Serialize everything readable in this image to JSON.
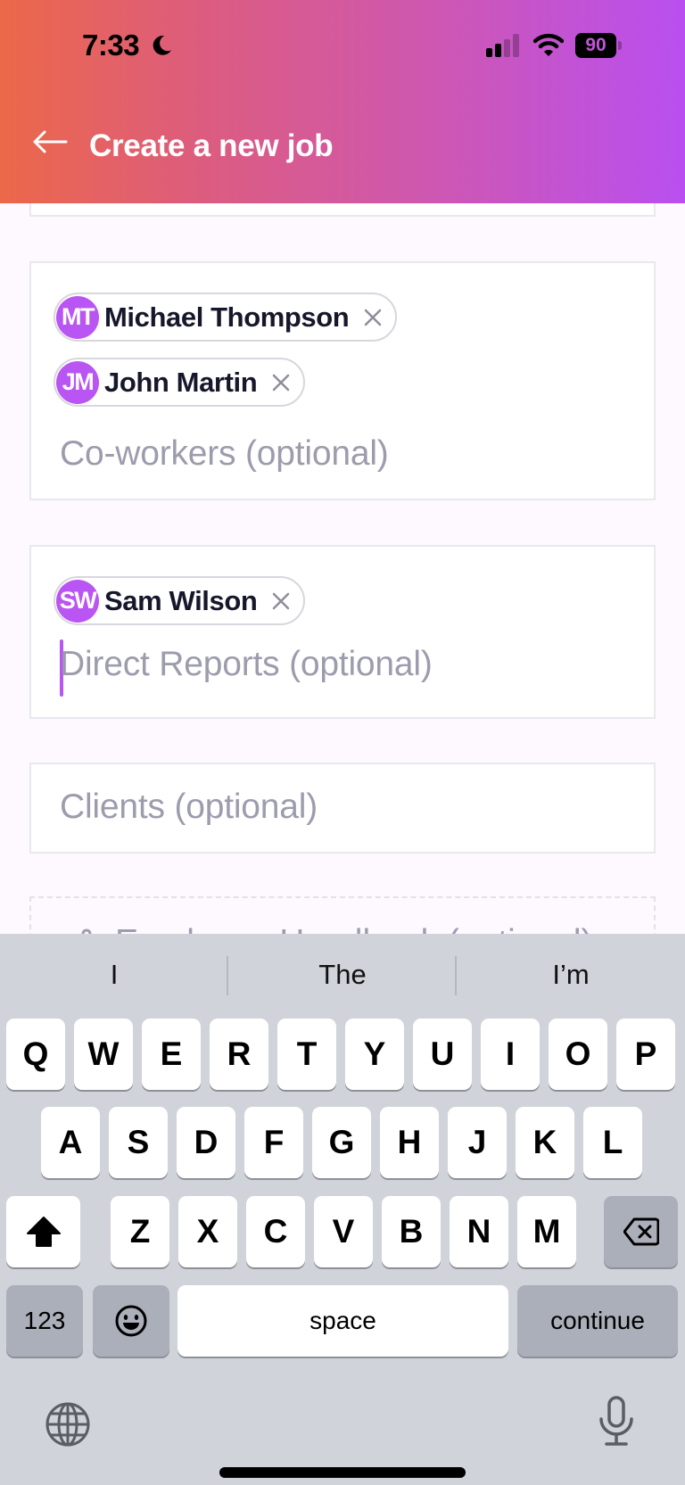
{
  "status_bar": {
    "time": "7:33",
    "focus_icon": "moon-icon",
    "battery_level": "90"
  },
  "header": {
    "title": "Create a new job",
    "back_icon": "arrow-left-icon",
    "gradient": [
      "#ec6849",
      "#b94ff0"
    ]
  },
  "form": {
    "coworkers": {
      "placeholder": "Co-workers (optional)",
      "chips": [
        {
          "initials": "MT",
          "name": "Michael Thompson"
        },
        {
          "initials": "JM",
          "name": "John Martin"
        }
      ]
    },
    "direct_reports": {
      "placeholder": "Direct Reports (optional)",
      "focused": true,
      "chips": [
        {
          "initials": "SW",
          "name": "Sam Wilson"
        }
      ]
    },
    "clients": {
      "placeholder": "Clients (optional)"
    },
    "handbook": {
      "label": "Employee Handbook (optional)",
      "icon": "paperclip-icon"
    }
  },
  "colors": {
    "accent": "#b955f2",
    "placeholder": "#9d9cad",
    "chip_text": "#17172b"
  },
  "keyboard": {
    "suggestions": [
      "I",
      "The",
      "I’m"
    ],
    "row1": [
      "Q",
      "W",
      "E",
      "R",
      "T",
      "Y",
      "U",
      "I",
      "O",
      "P"
    ],
    "row2": [
      "A",
      "S",
      "D",
      "F",
      "G",
      "H",
      "J",
      "K",
      "L"
    ],
    "row3": [
      "Z",
      "X",
      "C",
      "V",
      "B",
      "N",
      "M"
    ],
    "numbers_label": "123",
    "space_label": "space",
    "return_label": "continue"
  }
}
